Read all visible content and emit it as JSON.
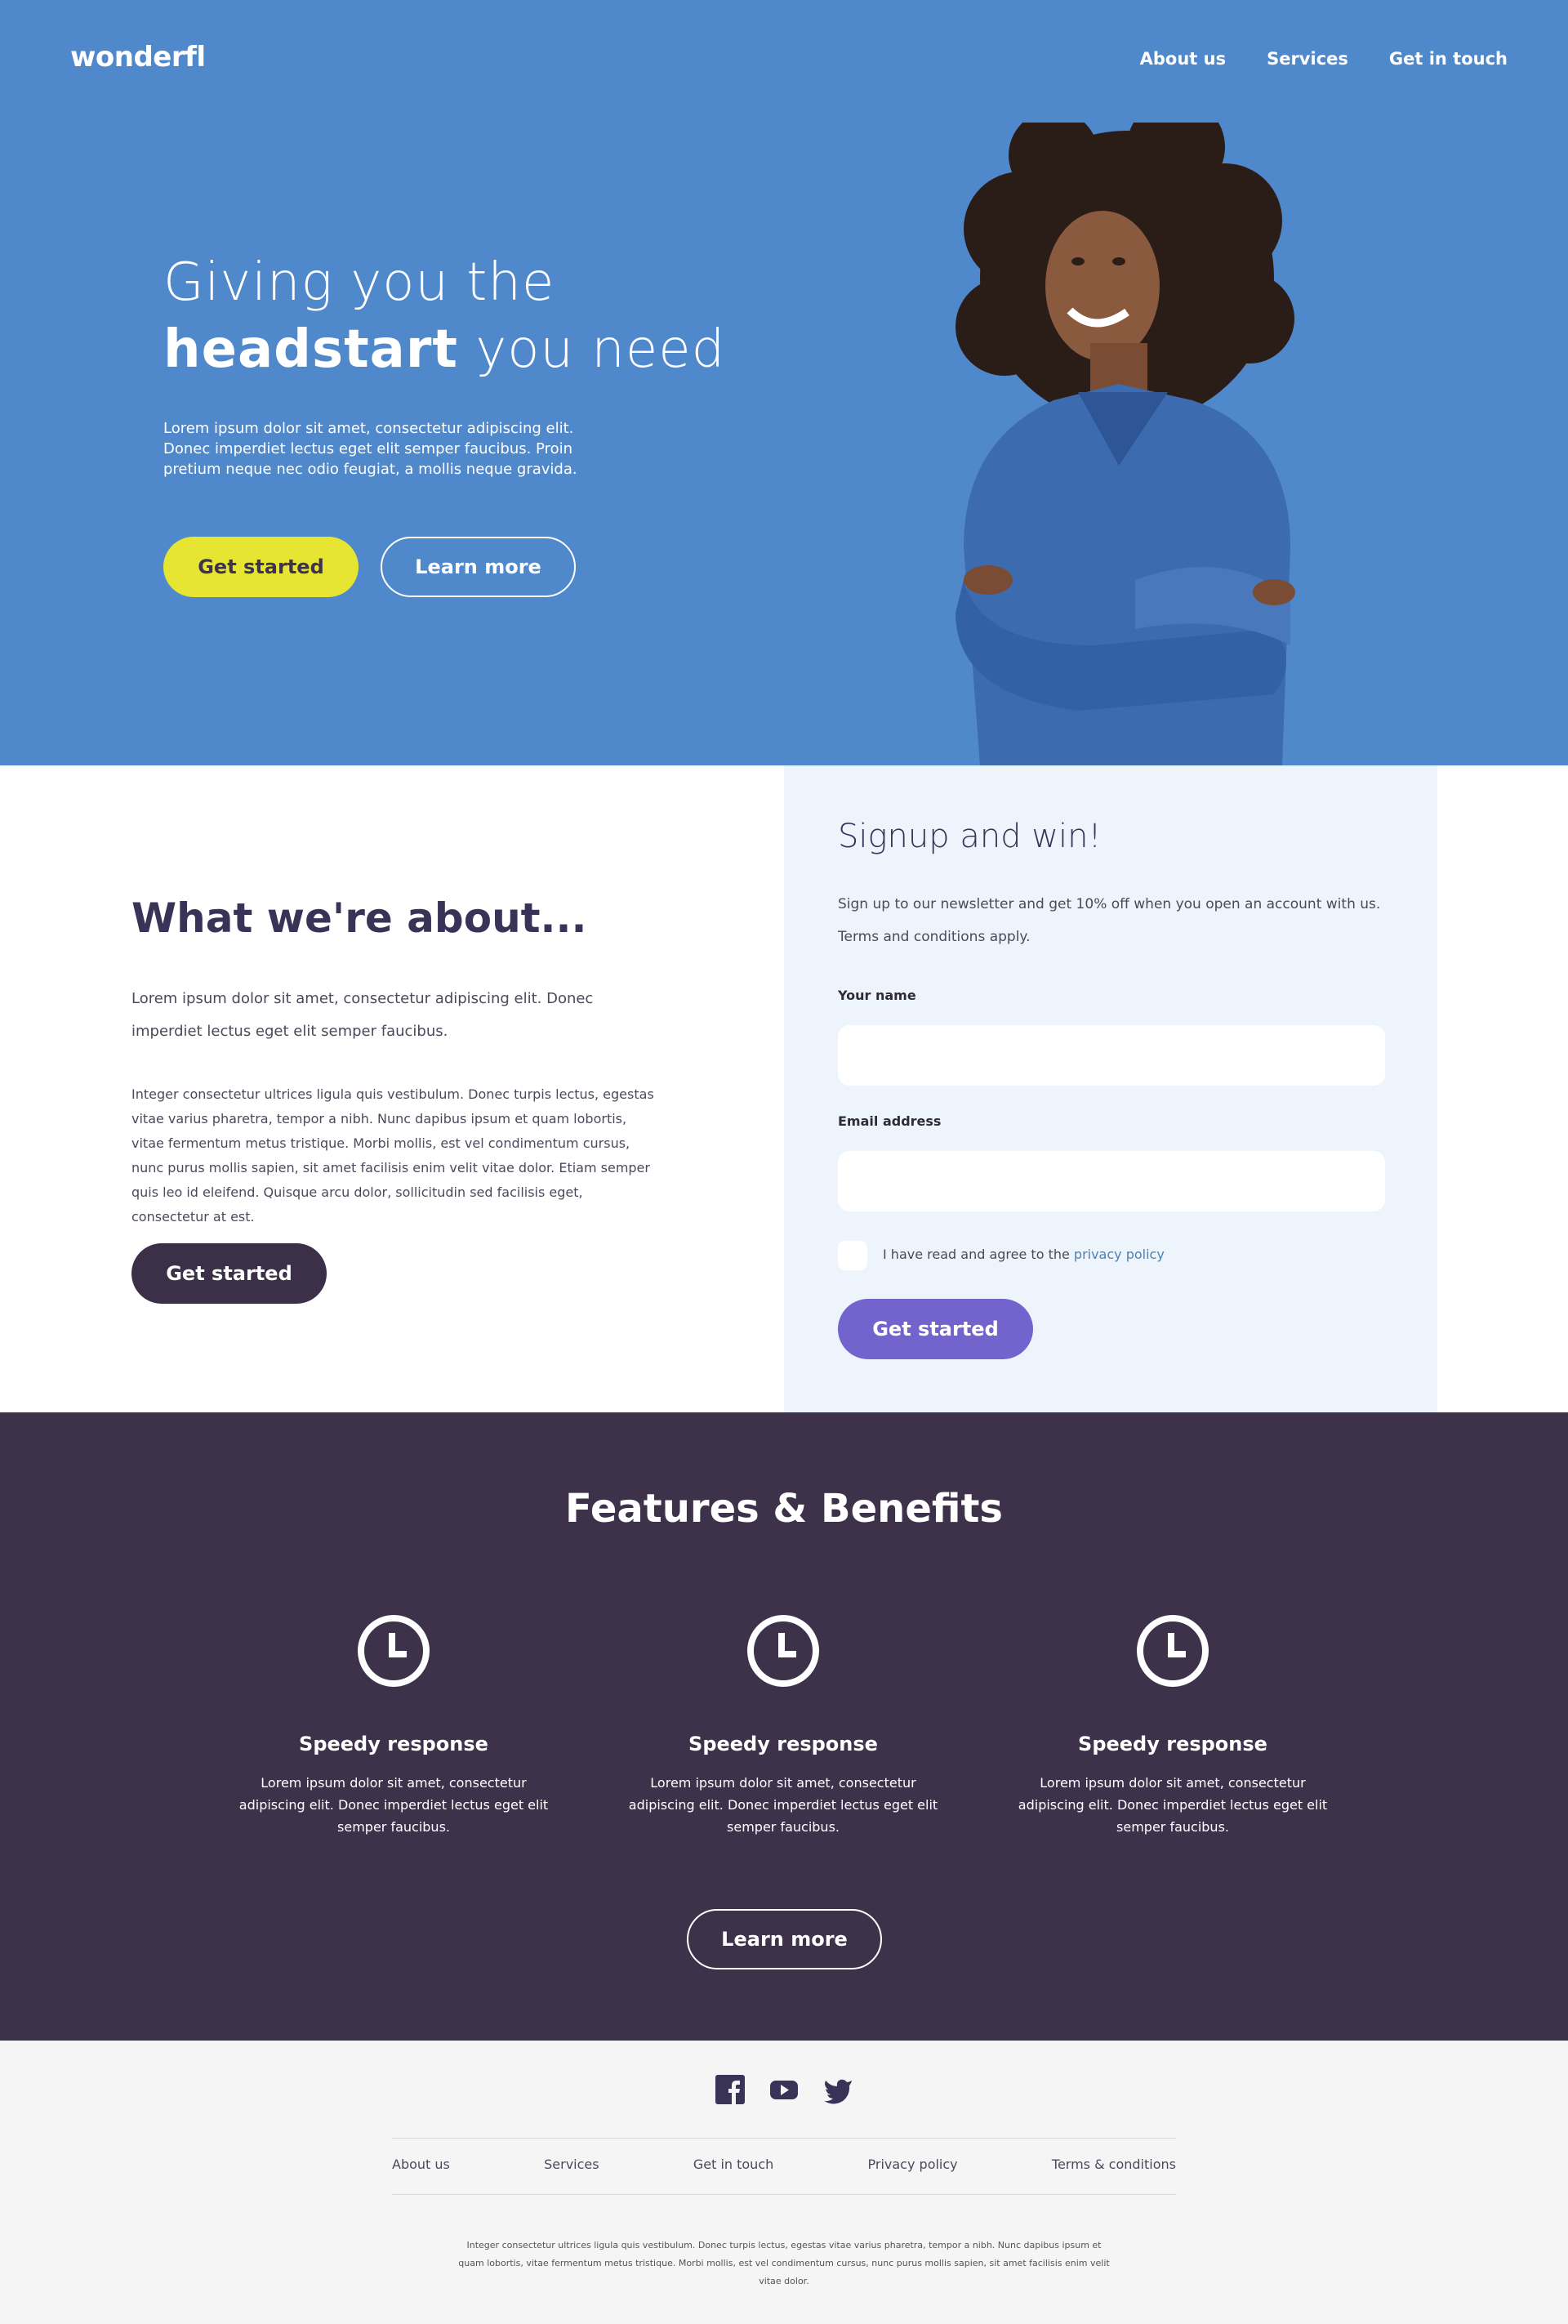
{
  "header": {
    "logo": "wonderfl",
    "nav": [
      "About us",
      "Services",
      "Get in touch"
    ]
  },
  "hero": {
    "title_line1": "Giving you the",
    "title_bold": "headstart",
    "title_rest": " you need",
    "text": "Lorem ipsum dolor sit amet, consectetur adipiscing elit. Donec imperdiet lectus eget elit semper faucibus. Proin pretium neque nec odio feugiat, a mollis neque gravida.",
    "primary_button": "Get started",
    "secondary_button": "Learn more",
    "background_color": "#5088cc",
    "image": "woman-smiling-denim-shirt"
  },
  "about": {
    "title": "What we're about...",
    "paragraph1": "Lorem ipsum dolor sit amet, consectetur adipiscing elit. Donec imperdiet lectus eget elit semper faucibus.",
    "paragraph2": "Integer consectetur ultrices ligula quis vestibulum. Donec turpis lectus, egestas vitae varius pharetra, tempor a nibh. Nunc dapibus ipsum et quam lobortis, vitae fermentum metus tristique. Morbi mollis, est vel condimentum cursus, nunc purus mollis sapien, sit amet facilisis enim velit vitae dolor. Etiam semper quis leo id eleifend. Quisque arcu dolor, sollicitudin sed facilisis eget, consectetur at est.",
    "button": "Get started"
  },
  "signup": {
    "title": "Signup and win!",
    "text": "Sign up to our newsletter and get 10% off when you open an account with us. Terms and conditions apply.",
    "name_label": "Your name",
    "name_value": "",
    "email_label": "Email address",
    "email_value": "",
    "checkbox_text": "I have read and agree to the ",
    "checkbox_link": "privacy policy",
    "checkbox_checked": false,
    "button": "Get started"
  },
  "features": {
    "title": "Features & Benefits",
    "items": [
      {
        "icon": "clock-icon",
        "title": "Speedy response",
        "text": "Lorem ipsum dolor sit amet, consectetur adipiscing elit. Donec imperdiet lectus eget elit semper faucibus."
      },
      {
        "icon": "clock-icon",
        "title": "Speedy response",
        "text": "Lorem ipsum dolor sit amet, consectetur adipiscing elit. Donec imperdiet lectus eget elit semper faucibus."
      },
      {
        "icon": "clock-icon",
        "title": "Speedy response",
        "text": "Lorem ipsum dolor sit amet, consectetur adipiscing elit. Donec imperdiet lectus eget elit semper faucibus."
      }
    ],
    "button": "Learn more"
  },
  "footer": {
    "social": [
      "facebook-icon",
      "youtube-icon",
      "twitter-icon"
    ],
    "nav": [
      "About us",
      "Services",
      "Get in touch",
      "Privacy policy",
      "Terms & conditions"
    ],
    "text": "Integer consectetur ultrices ligula quis vestibulum. Donec turpis lectus, egestas vitae varius pharetra, tempor a nibh. Nunc dapibus ipsum et quam lobortis, vitae fermentum metus tristique. Morbi mollis, est vel condimentum cursus, nunc purus mollis sapien, sit amet facilisis enim velit vitae dolor."
  },
  "colors": {
    "brand_blue": "#5088cc",
    "accent_yellow": "#e6e531",
    "dark_purple": "#3e324b",
    "button_purple": "#7363cc",
    "signup_bg": "#eef4fb",
    "footer_bg": "#f5f5f5"
  }
}
